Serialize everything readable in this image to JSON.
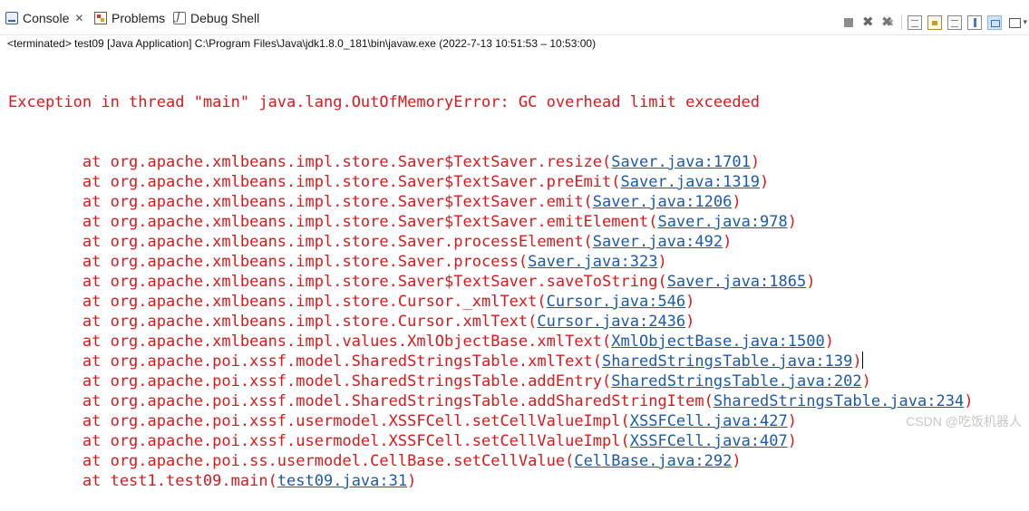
{
  "tabs": [
    {
      "label": "Console",
      "icon": "console-icon",
      "closable": true,
      "active": true
    },
    {
      "label": "Problems",
      "icon": "problems-icon"
    },
    {
      "label": "Debug Shell",
      "icon": "debug-shell-icon"
    }
  ],
  "toolbar_icons": [
    "terminate-icon",
    "remove-launch-icon",
    "remove-all-terminated-icon",
    "show-console-on-output-icon",
    "scroll-lock-icon",
    "word-wrap-icon",
    "pin-console-icon",
    "display-selected-console-icon",
    "open-console-icon"
  ],
  "status_line": "<terminated> test09 [Java Application] C:\\Program Files\\Java\\jdk1.8.0_181\\bin\\javaw.exe  (2022-7-13 10:51:53 – 10:53:00)",
  "exception_line": "Exception in thread \"main\" java.lang.OutOfMemoryError: GC overhead limit exceeded",
  "stack": [
    {
      "method": "org.apache.xmlbeans.impl.store.Saver$TextSaver.resize",
      "link": "Saver.java:1701"
    },
    {
      "method": "org.apache.xmlbeans.impl.store.Saver$TextSaver.preEmit",
      "link": "Saver.java:1319"
    },
    {
      "method": "org.apache.xmlbeans.impl.store.Saver$TextSaver.emit",
      "link": "Saver.java:1206"
    },
    {
      "method": "org.apache.xmlbeans.impl.store.Saver$TextSaver.emitElement",
      "link": "Saver.java:978"
    },
    {
      "method": "org.apache.xmlbeans.impl.store.Saver.processElement",
      "link": "Saver.java:492"
    },
    {
      "method": "org.apache.xmlbeans.impl.store.Saver.process",
      "link": "Saver.java:323"
    },
    {
      "method": "org.apache.xmlbeans.impl.store.Saver$TextSaver.saveToString",
      "link": "Saver.java:1865"
    },
    {
      "method": "org.apache.xmlbeans.impl.store.Cursor._xmlText",
      "link": "Cursor.java:546"
    },
    {
      "method": "org.apache.xmlbeans.impl.store.Cursor.xmlText",
      "link": "Cursor.java:2436"
    },
    {
      "method": "org.apache.xmlbeans.impl.values.XmlObjectBase.xmlText",
      "link": "XmlObjectBase.java:1500"
    },
    {
      "method": "org.apache.poi.xssf.model.SharedStringsTable.xmlText",
      "link": "SharedStringsTable.java:139",
      "caret": true
    },
    {
      "method": "org.apache.poi.xssf.model.SharedStringsTable.addEntry",
      "link": "SharedStringsTable.java:202"
    },
    {
      "method": "org.apache.poi.xssf.model.SharedStringsTable.addSharedStringItem",
      "link": "SharedStringsTable.java:234"
    },
    {
      "method": "org.apache.poi.xssf.usermodel.XSSFCell.setCellValueImpl",
      "link": "XSSFCell.java:427"
    },
    {
      "method": "org.apache.poi.xssf.usermodel.XSSFCell.setCellValueImpl",
      "link": "XSSFCell.java:407"
    },
    {
      "method": "org.apache.poi.ss.usermodel.CellBase.setCellValue",
      "link": "CellBase.java:292"
    },
    {
      "method": "test1.test09.main",
      "link": "test09.java:31"
    }
  ],
  "watermark": "CSDN @吃饭机器人",
  "colors": {
    "error_text": "#d9191c",
    "link": "#1d5aa6"
  }
}
